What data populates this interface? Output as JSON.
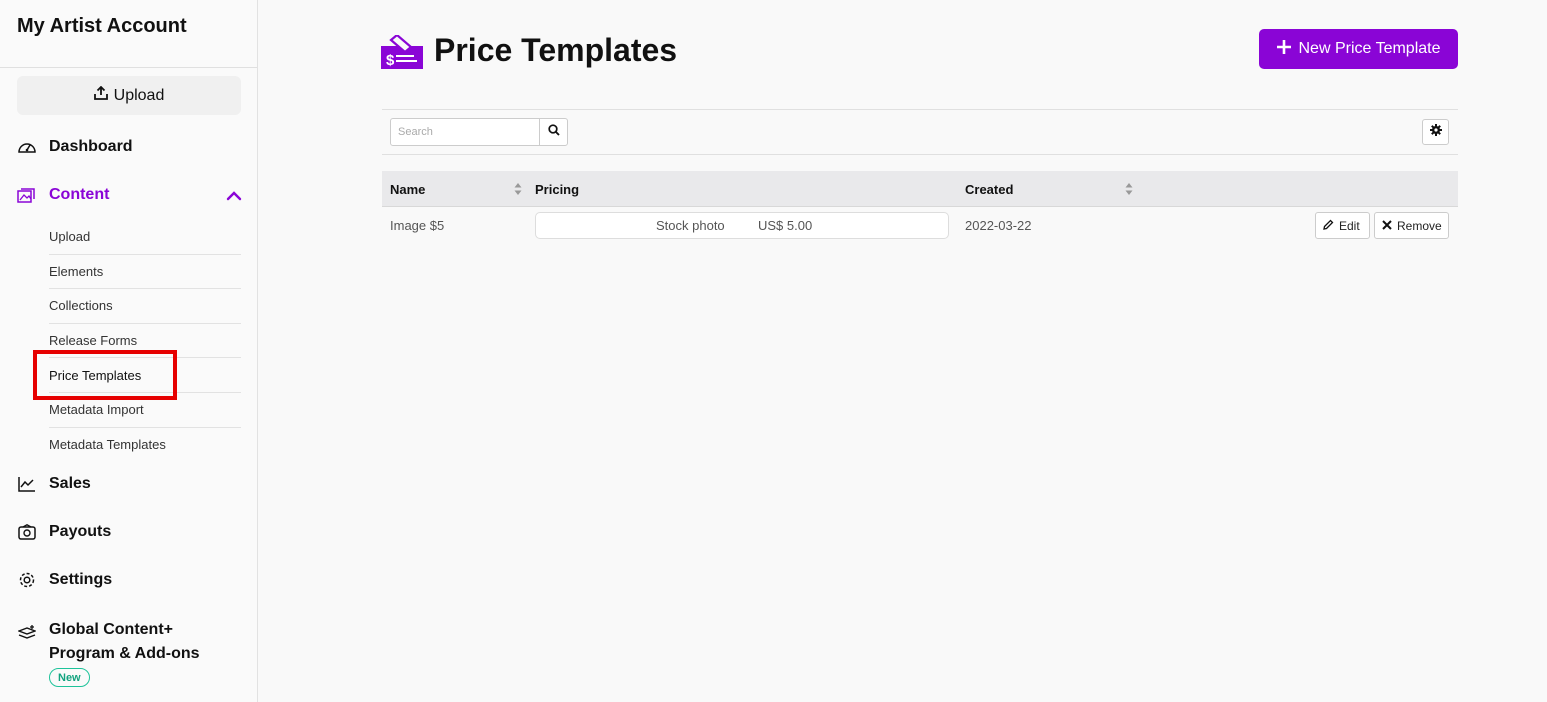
{
  "sidebar": {
    "account_title": "My Artist Account",
    "upload_label": "Upload",
    "nav": {
      "dashboard": "Dashboard",
      "content": "Content",
      "sales": "Sales",
      "payouts": "Payouts",
      "settings": "Settings",
      "global_content": "Global Content+ Program & Add-ons"
    },
    "content_items": [
      "Upload",
      "Elements",
      "Collections",
      "Release Forms",
      "Price Templates",
      "Metadata Import",
      "Metadata Templates"
    ],
    "new_badge": "New",
    "active_section": "Content",
    "current_item": "Price Templates"
  },
  "header": {
    "title": "Price Templates",
    "new_button_label": "New Price Template"
  },
  "search": {
    "placeholder": "Search",
    "value": ""
  },
  "table": {
    "columns": [
      "Name",
      "Pricing",
      "Created"
    ],
    "rows": [
      {
        "name": "Image $5",
        "pricing_type": "Stock photo",
        "pricing_value": "US$ 5.00",
        "created": "2022-03-22",
        "edit_label": "Edit",
        "remove_label": "Remove"
      }
    ]
  },
  "colors": {
    "accent": "#8a05d6",
    "highlight": "#e60000",
    "badge": "#1ec39a"
  },
  "icons": [
    "upload-icon",
    "dashboard-icon",
    "content-icon",
    "chevron-up-icon",
    "sales-icon",
    "payouts-icon",
    "settings-icon",
    "global-content-icon",
    "price-tag-icon",
    "plus-icon",
    "search-icon",
    "gear-icon",
    "sort-icon",
    "pencil-icon",
    "close-icon"
  ]
}
